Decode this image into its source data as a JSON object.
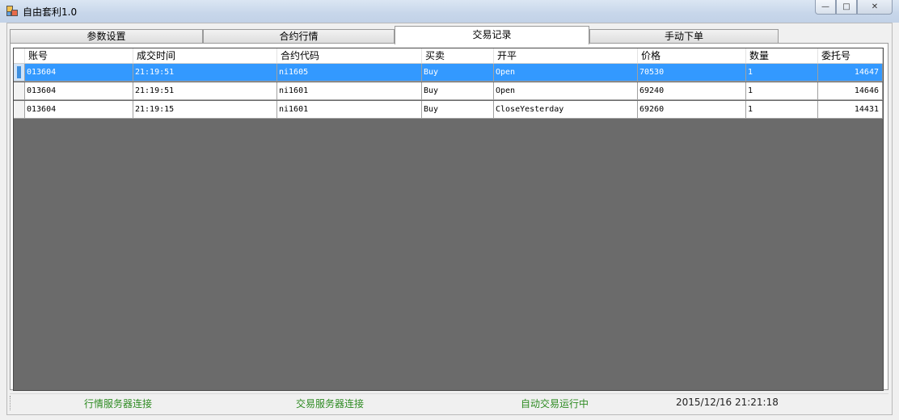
{
  "window": {
    "title": "自由套利1.0",
    "icon": "app-icon",
    "caption_buttons": [
      {
        "name": "minimize",
        "glyph": "—"
      },
      {
        "name": "maximize",
        "glyph": "□"
      },
      {
        "name": "close",
        "glyph": "✕"
      }
    ]
  },
  "tabs": [
    {
      "label": "参数设置",
      "active": false
    },
    {
      "label": "合约行情",
      "active": false
    },
    {
      "label": "交易记录",
      "active": true
    },
    {
      "label": "手动下单",
      "active": false
    }
  ],
  "grid": {
    "columns": [
      "账号",
      "成交时间",
      "合约代码",
      "买卖",
      "开平",
      "价格",
      "数量",
      "委托号"
    ],
    "rows": [
      {
        "selected": true,
        "cells": [
          "013604",
          "21:19:51",
          "ni1605",
          "Buy",
          "Open",
          "70530",
          "1",
          "14647"
        ]
      },
      {
        "selected": false,
        "cells": [
          "013604",
          "21:19:51",
          "ni1601",
          "Buy",
          "Open",
          "69240",
          "1",
          "14646"
        ]
      },
      {
        "selected": false,
        "cells": [
          "013604",
          "21:19:15",
          "ni1601",
          "Buy",
          "CloseYesterday",
          "69260",
          "1",
          "14431"
        ]
      }
    ]
  },
  "statusbar": {
    "market_server": "行情服务器连接",
    "trade_server": "交易服务器连接",
    "auto_trading": "自动交易运行中",
    "datetime": "2015/12/16 21:21:18"
  },
  "colors": {
    "selection": "#3399ff",
    "grid_background": "#6b6b6b",
    "status_green": "#2e8b22"
  }
}
